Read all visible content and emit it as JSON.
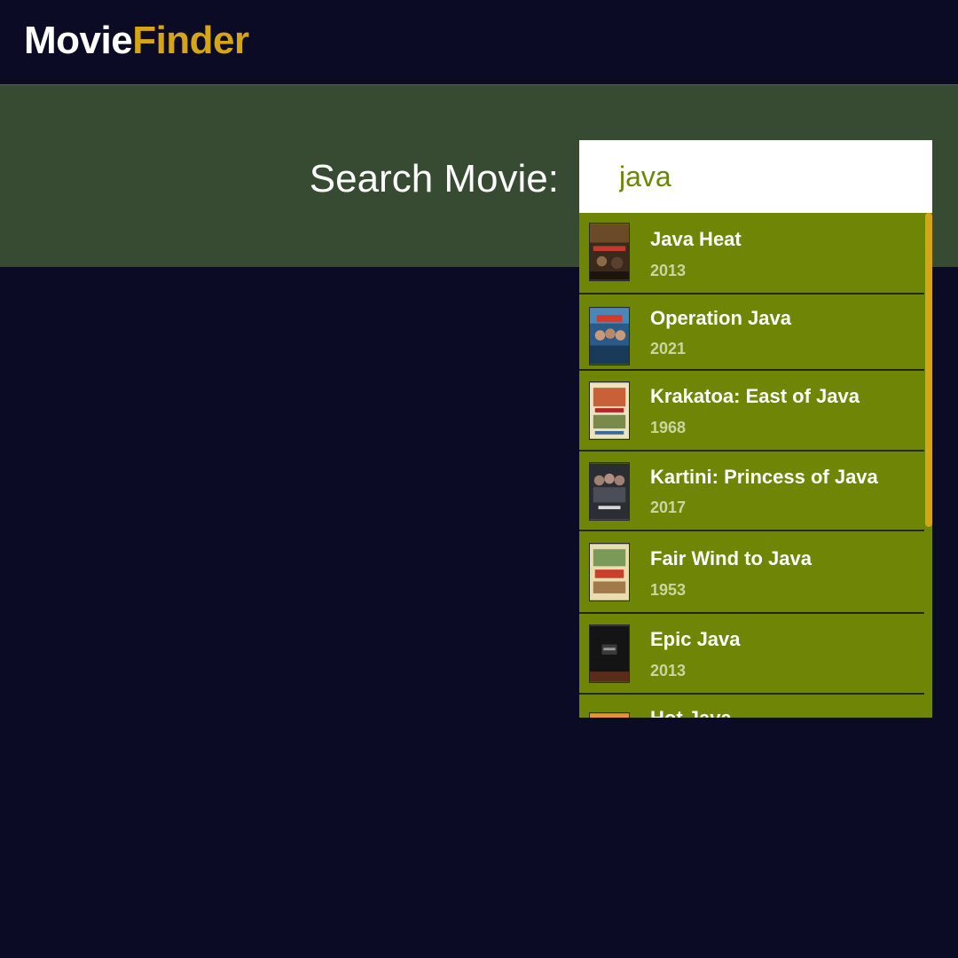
{
  "header": {
    "logo_part1": "Movie",
    "logo_part2": "Finder"
  },
  "search": {
    "label": "Search Movie:",
    "value": "java"
  },
  "results": [
    {
      "title": "Java Heat",
      "year": "2013",
      "poster": "poster-java-heat"
    },
    {
      "title": "Operation Java",
      "year": "2021",
      "poster": "poster-operation-java"
    },
    {
      "title": "Krakatoa: East of Java",
      "year": "1968",
      "poster": "poster-krakatoa"
    },
    {
      "title": "Kartini: Princess of Java",
      "year": "2017",
      "poster": "poster-kartini"
    },
    {
      "title": "Fair Wind to Java",
      "year": "1953",
      "poster": "poster-fair-wind"
    },
    {
      "title": "Epic Java",
      "year": "2013",
      "poster": "poster-epic-java"
    },
    {
      "title": "Hot Java",
      "year": "",
      "poster": "poster-hot-java"
    }
  ],
  "colors": {
    "background": "#0b0b26",
    "search_band": "#374b33",
    "accent": "#d4a514",
    "dropdown_item": "#6e8505"
  }
}
